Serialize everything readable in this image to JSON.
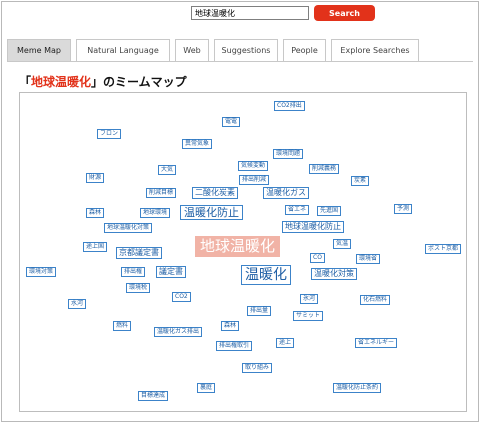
{
  "search": {
    "value": "地球温暖化",
    "button_label": "Search"
  },
  "tabs": [
    {
      "label": "Meme Map",
      "active": true
    },
    {
      "label": "Natural Language",
      "active": false
    },
    {
      "label": "Web",
      "active": false
    },
    {
      "label": "Suggestions",
      "active": false
    },
    {
      "label": "People",
      "active": false
    },
    {
      "label": "Explore Searches",
      "active": false
    }
  ],
  "title": {
    "open": "「",
    "keyword": "地球温暖化",
    "rest": "」のミームマップ"
  },
  "center_term": "地球温暖化",
  "terms": [
    "CO2排出",
    "電電",
    "フロン",
    "異常気象",
    "環境問題",
    "気候変動",
    "削減義務",
    "大気",
    "排出削減",
    "財源",
    "削減目標",
    "二酸化炭素",
    "温暖化ガス",
    "炭素",
    "予測",
    "森林",
    "地球環境",
    "温暖化防止",
    "省エネ",
    "先進国",
    "地球温暖化対策",
    "地球温暖化防止",
    "途上国",
    "京都議定書",
    "CO",
    "気温",
    "ポスト京都",
    "環境対策",
    "排出権",
    "環境省",
    "議定書",
    "温暖化",
    "環境税",
    "CO2",
    "温暖化対策",
    "水河",
    "氷河",
    "排出量",
    "化石燃料",
    "サミット",
    "燃料",
    "温暖化ガス排出",
    "森林",
    "排出権取引",
    "途上",
    "省エネルギー",
    "目標達成",
    "裏庭",
    "取り組み",
    "温暖化防止条約"
  ],
  "colors": {
    "accent": "#e2321a",
    "term_border": "#3c83c9",
    "term_text": "#1f5fa5",
    "center_bg": "#f1b3a6"
  }
}
